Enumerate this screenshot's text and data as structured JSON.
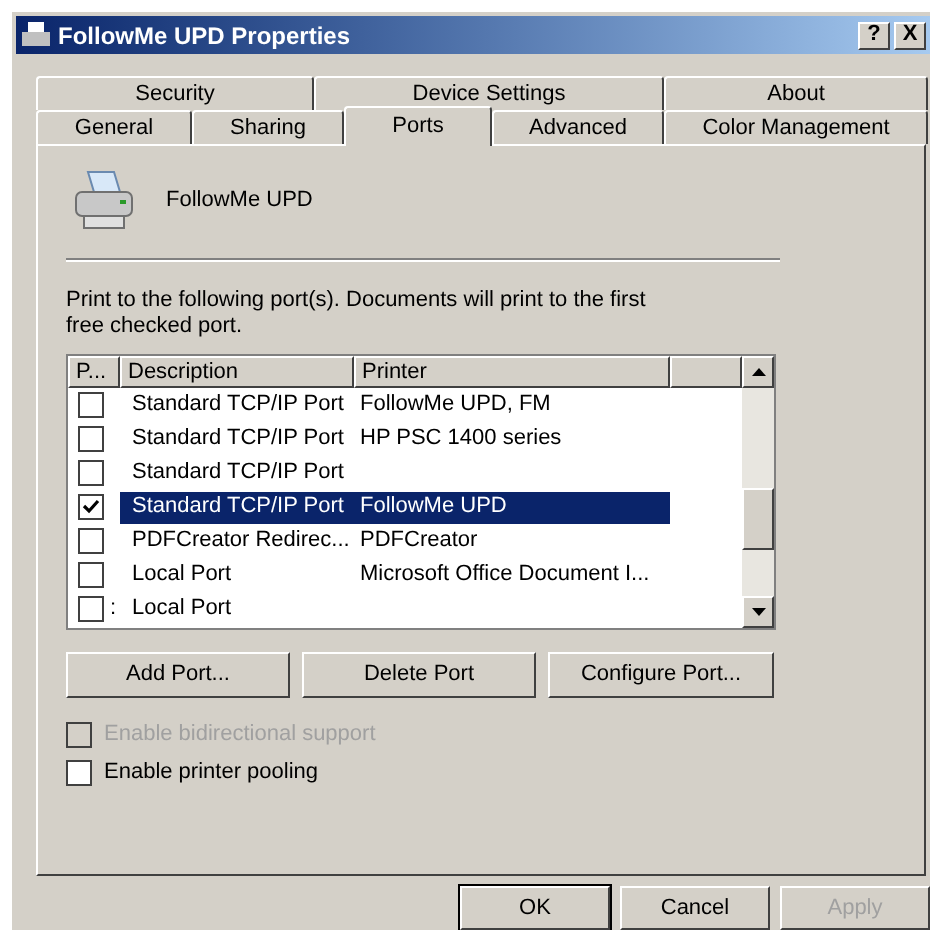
{
  "window": {
    "title": "FollowMe UPD Properties",
    "help_button": "?",
    "close_button": "X"
  },
  "tab_rows": [
    [
      {
        "label": "Security",
        "selected": false
      },
      {
        "label": "Device Settings",
        "selected": false
      },
      {
        "label": "About",
        "selected": false
      }
    ],
    [
      {
        "label": "General",
        "selected": false
      },
      {
        "label": "Sharing",
        "selected": false
      },
      {
        "label": "Ports",
        "selected": true
      },
      {
        "label": "Advanced",
        "selected": false
      },
      {
        "label": "Color Management",
        "selected": false
      }
    ]
  ],
  "printer_name": "FollowMe UPD",
  "instructions": "Print to the following port(s). Documents will print to the first free checked port.",
  "ports_table": {
    "columns": [
      "P...",
      "Description",
      "Printer"
    ],
    "rows": [
      {
        "port": "",
        "description": "Standard TCP/IP Port",
        "printer": "FollowMe  UPD, FM",
        "checked": false,
        "selected": false
      },
      {
        "port": "",
        "description": "Standard TCP/IP Port",
        "printer": "HP PSC 1400 series",
        "checked": false,
        "selected": false
      },
      {
        "port": "",
        "description": "Standard TCP/IP Port",
        "printer": "",
        "checked": false,
        "selected": false
      },
      {
        "port": "",
        "description": "Standard TCP/IP Port",
        "printer": "FollowMe UPD",
        "checked": true,
        "selected": true
      },
      {
        "port": "",
        "description": "PDFCreator Redirec...",
        "printer": "PDFCreator",
        "checked": false,
        "selected": false
      },
      {
        "port": "",
        "description": "Local Port",
        "printer": "Microsoft Office Document I...",
        "checked": false,
        "selected": false
      },
      {
        "port": ":",
        "description": "Local Port",
        "printer": "",
        "checked": false,
        "selected": false
      }
    ]
  },
  "port_buttons": [
    "Add Port...",
    "Delete Port",
    "Configure Port..."
  ],
  "options": [
    {
      "label": "Enable bidirectional support",
      "checked": false,
      "disabled": true
    },
    {
      "label": "Enable printer pooling",
      "checked": false,
      "disabled": false
    }
  ],
  "dialog_buttons": [
    {
      "label": "OK",
      "disabled": false,
      "default": true
    },
    {
      "label": "Cancel",
      "disabled": false,
      "default": false
    },
    {
      "label": "Apply",
      "disabled": true,
      "default": false
    }
  ]
}
